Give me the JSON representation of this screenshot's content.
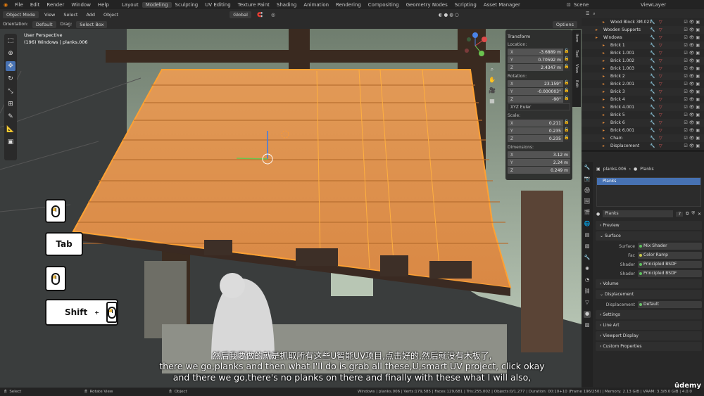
{
  "menu": {
    "items": [
      "File",
      "Edit",
      "Render",
      "Window",
      "Help"
    ],
    "workspaces": [
      "Layout",
      "Modeling",
      "Sculpting",
      "UV Editing",
      "Texture Paint",
      "Shading",
      "Animation",
      "Rendering",
      "Compositing",
      "Geometry Nodes",
      "Scripting",
      "Asset Manager"
    ],
    "active_workspace": "Modeling",
    "scene": "Scene",
    "view_layer": "ViewLayer"
  },
  "header": {
    "mode": "Object Mode",
    "menus": [
      "View",
      "Select",
      "Add",
      "Object"
    ],
    "orientation_label": "Orientation:",
    "orientation_value": "Default",
    "drag_label": "Drag:",
    "drag_value": "Select Box",
    "transform_orientation": "Global",
    "options": "Options"
  },
  "viewport": {
    "perspective": "User Perspective",
    "object_info": "(196) Windows | planks.006"
  },
  "npanel": {
    "title": "Transform",
    "location_label": "Location:",
    "location": [
      {
        "axis": "X",
        "value": "-3.6889 m"
      },
      {
        "axis": "Y",
        "value": "0.70592 m"
      },
      {
        "axis": "Z",
        "value": "2.4347 m"
      }
    ],
    "rotation_label": "Rotation:",
    "rotation": [
      {
        "axis": "X",
        "value": "23.159°"
      },
      {
        "axis": "Y",
        "value": "-0.000003°"
      },
      {
        "axis": "Z",
        "value": "-90°"
      }
    ],
    "rotation_mode": "XYZ Euler",
    "scale_label": "Scale:",
    "scale": [
      {
        "axis": "X",
        "value": "0.211"
      },
      {
        "axis": "Y",
        "value": "0.235"
      },
      {
        "axis": "Z",
        "value": "0.235"
      }
    ],
    "dimensions_label": "Dimensions:",
    "dimensions": [
      {
        "axis": "X",
        "value": "3.12 m"
      },
      {
        "axis": "Y",
        "value": "2.24 m"
      },
      {
        "axis": "Z",
        "value": "0.249 m"
      }
    ],
    "tabs": [
      "Item",
      "Tool",
      "View",
      "Edit"
    ]
  },
  "keys": {
    "tab": "Tab",
    "shift": "Shift",
    "plus": "+"
  },
  "outliner": {
    "rows": [
      {
        "name": "Wood Block 3M.021",
        "indent": 2
      },
      {
        "name": "Wooden Supports",
        "indent": 1
      },
      {
        "name": "Windows",
        "indent": 1
      },
      {
        "name": "Brick 1",
        "indent": 2
      },
      {
        "name": "Brick 1.001",
        "indent": 2
      },
      {
        "name": "Brick 1.002",
        "indent": 2
      },
      {
        "name": "Brick 1.003",
        "indent": 2
      },
      {
        "name": "Brick 2",
        "indent": 2
      },
      {
        "name": "Brick 2.001",
        "indent": 2
      },
      {
        "name": "Brick 3",
        "indent": 2
      },
      {
        "name": "Brick 4",
        "indent": 2
      },
      {
        "name": "Brick 4.001",
        "indent": 2
      },
      {
        "name": "Brick 5",
        "indent": 2
      },
      {
        "name": "Brick 6",
        "indent": 2
      },
      {
        "name": "Brick 6.001",
        "indent": 2
      },
      {
        "name": "Chain",
        "indent": 2
      },
      {
        "name": "Displacement",
        "indent": 2
      }
    ]
  },
  "properties": {
    "breadcrumb_object": "planks.006",
    "breadcrumb_material": "Planks",
    "material_slot": "Planks",
    "material_name": "Planks",
    "material_users": "7",
    "panels": {
      "preview": "Preview",
      "surface": "Surface",
      "volume": "Volume",
      "displacement": "Displacement",
      "settings": "Settings",
      "line_art": "Line Art",
      "viewport_display": "Viewport Display",
      "custom_properties": "Custom Properties"
    },
    "surface_label": "Surface",
    "surface_value": "Mix Shader",
    "fac_label": "Fac",
    "fac_value": "Color Ramp",
    "shader1_label": "Shader",
    "shader1_value": "Principled BSDF",
    "shader2_label": "Shader",
    "shader2_value": "Principled BSDF",
    "disp_label": "Displacement",
    "disp_value": "Default"
  },
  "subtitles": {
    "chinese": "然后我要做的就是抓取所有这些U智能UV项目,点击好的,然后就没有木板了,",
    "line1": "there we go,planks and then what I'll do is grab all these,U,smart UV project, click okay",
    "line2": "and there we go,there's no planks on there and finally with these what I will also,"
  },
  "status": {
    "select": "Select",
    "rotate": "Rotate View",
    "object": "Object",
    "info": "Windows | planks.006 | Verts:179,585 | Faces:129,681 | Tris:255,002 | Objects:0/1,277 | Duration: 00:10+10 (Frame 196/250) | Memory: 2.13 GiB | VRAM: 3.3/8.0 GiB | 4.0.0"
  },
  "brand": "ûdemy"
}
